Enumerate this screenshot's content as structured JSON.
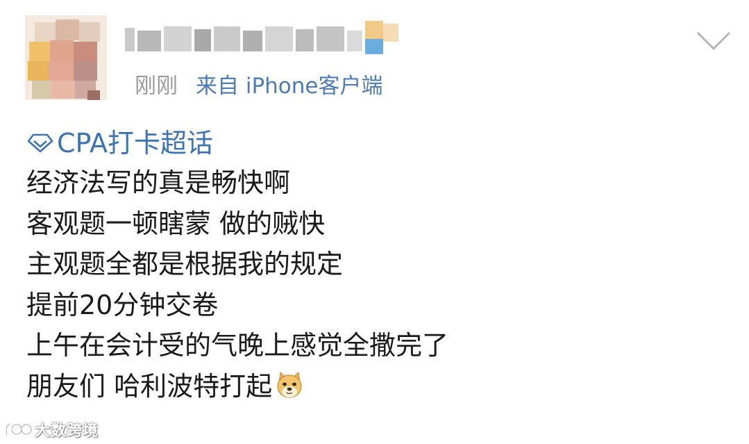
{
  "post": {
    "meta": {
      "time": "刚刚",
      "source": "来自 iPhone客户端"
    },
    "topic": {
      "icon": "super-topic-diamond-icon",
      "label": "CPA打卡超话"
    },
    "lines": [
      "经济法写的真是畅快啊",
      "客观题一顿瞎蒙 做的贼快",
      "主观题全都是根据我的规定",
      "提前20分钟交卷",
      "上午在会计受的气晚上感觉全撒完了",
      "朋友们 哈利波特打起"
    ],
    "trailing_emoji": "doge-emoji-icon"
  },
  "watermark": {
    "text": "大数跨境"
  },
  "colors": {
    "link": "#3e73b0",
    "meta": "#9a9a9a",
    "source": "#4e7bb3",
    "text": "#1a1a1a"
  }
}
